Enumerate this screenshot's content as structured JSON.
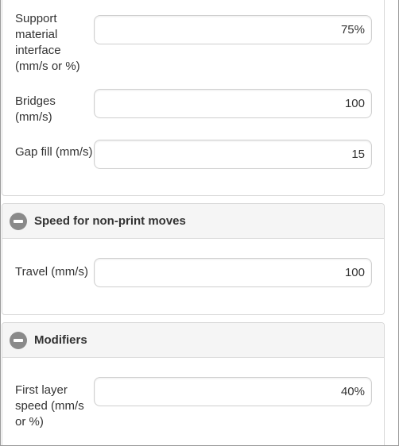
{
  "speed_panel": {
    "fields": [
      {
        "label": "Support material interface (mm/s or %)",
        "value": "75%"
      },
      {
        "label": "Bridges (mm/s)",
        "value": "100"
      },
      {
        "label": "Gap fill (mm/s)",
        "value": "15"
      }
    ]
  },
  "non_print_panel": {
    "title": "Speed for non-print moves",
    "icon": "collapse-minus-icon",
    "fields": [
      {
        "label": "Travel (mm/s)",
        "value": "100"
      }
    ]
  },
  "modifiers_panel": {
    "title": "Modifiers",
    "icon": "collapse-minus-icon",
    "fields": [
      {
        "label": "First layer speed (mm/s or %)",
        "value": "40%"
      }
    ]
  }
}
